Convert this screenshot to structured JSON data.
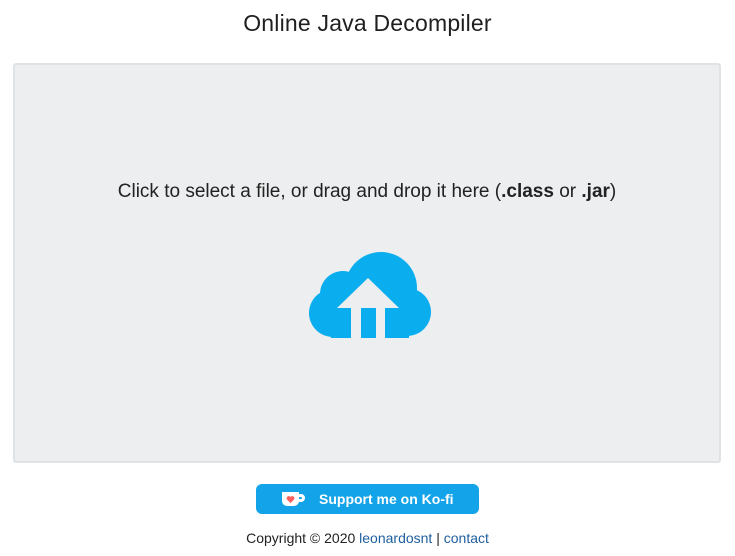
{
  "header": {
    "title": "Online Java Decompiler"
  },
  "dropzone": {
    "prompt": "Click to select a file, or drag and drop it here (",
    "ext_class": ".class",
    "or_text": " or ",
    "ext_jar": ".jar",
    "close_paren": ")",
    "icon": "cloud-upload-icon",
    "icon_color": "#0aaeef"
  },
  "kofi": {
    "label": "Support me on Ko-fi",
    "icon": "kofi-cup-icon",
    "color": "#13a3e8"
  },
  "footer": {
    "copyright": "Copyright © 2020 ",
    "author_link": "leonardosnt",
    "separator": " | ",
    "contact_link": "contact",
    "link_color": "#1f5fa0"
  }
}
